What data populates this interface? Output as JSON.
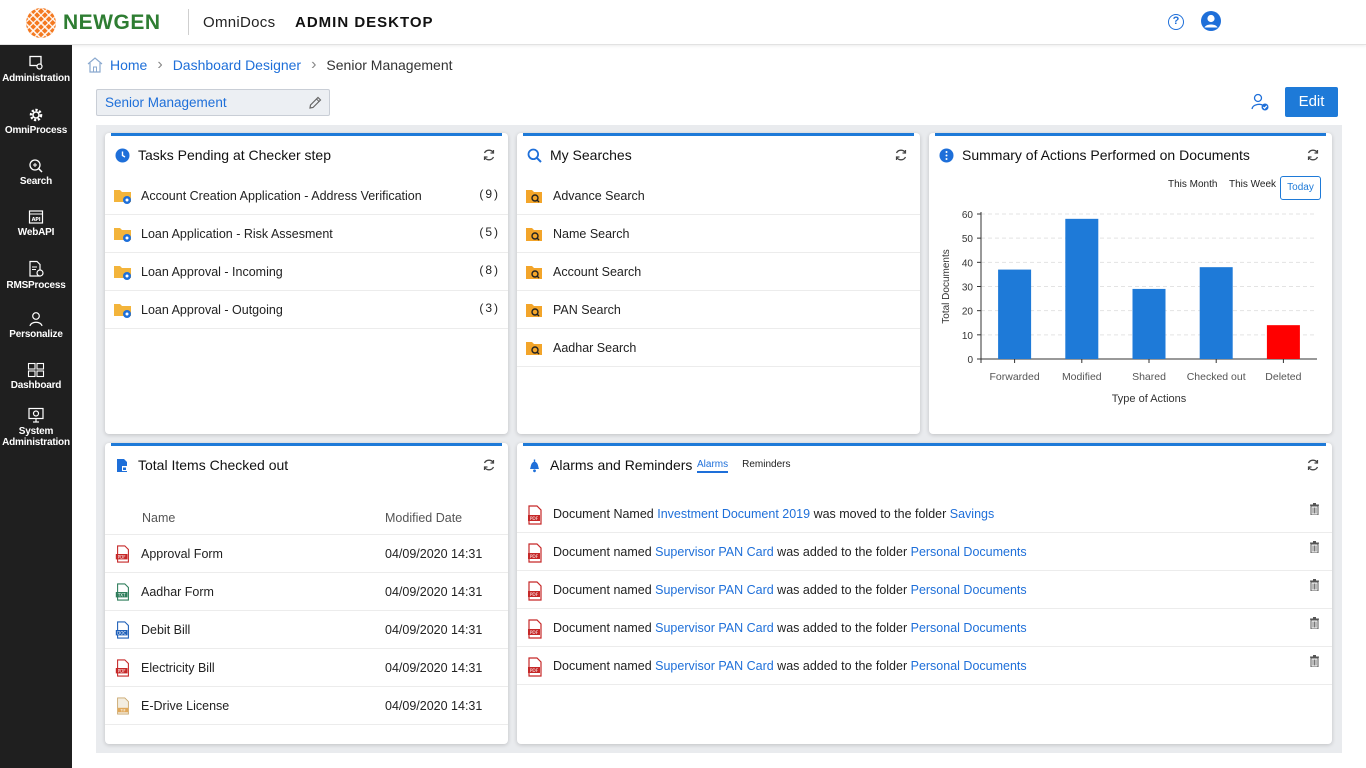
{
  "topbar": {
    "brand": "NEWGEN",
    "product": "OmniDocs",
    "app_title": "ADMIN DESKTOP"
  },
  "rail": [
    {
      "label": "Administration",
      "icon": "administration-icon"
    },
    {
      "label": "OmniProcess",
      "icon": "gear-icon"
    },
    {
      "label": "Search",
      "icon": "search-icon"
    },
    {
      "label": "WebAPI",
      "icon": "api-icon"
    },
    {
      "label": "RMSProcess",
      "icon": "document-gear-icon"
    },
    {
      "label": "Personalize",
      "icon": "person-icon"
    },
    {
      "label": "Dashboard",
      "icon": "dashboard-icon"
    },
    {
      "label": "System",
      "label2": "Administration",
      "icon": "monitor-gear-icon"
    }
  ],
  "breadcrumb": {
    "home": "Home",
    "designer": "Dashboard Designer",
    "current": "Senior Management"
  },
  "title": {
    "dashboard_name": "Senior Management",
    "edit_label": "Edit"
  },
  "tasks": {
    "title": "Tasks Pending at Checker step",
    "items": [
      {
        "label": "Account Creation Application - Address Verification",
        "count": "(9)"
      },
      {
        "label": "Loan Application - Risk Assesment",
        "count": "(5)"
      },
      {
        "label": "Loan Approval - Incoming",
        "count": "(8)"
      },
      {
        "label": "Loan Approval - Outgoing",
        "count": "(3)"
      }
    ]
  },
  "searches": {
    "title": "My Searches",
    "items": [
      "Advance Search",
      "Name Search",
      "Account Search",
      "PAN Search",
      "Aadhar Search"
    ]
  },
  "summary": {
    "title": "Summary of Actions Performed on Documents",
    "periods": [
      "This Month",
      "This Week",
      "Today"
    ],
    "selected_period": "Today"
  },
  "chart_data": {
    "type": "bar",
    "categories": [
      "Forwarded",
      "Modified",
      "Shared",
      "Checked out",
      "Deleted"
    ],
    "values": [
      37,
      58,
      29,
      38,
      14
    ],
    "colors": [
      "#1e7ad8",
      "#1e7ad8",
      "#1e7ad8",
      "#1e7ad8",
      "#ff0000"
    ],
    "xlabel": "Type of Actions",
    "ylabel": "Total Documents",
    "ylim": [
      0,
      60
    ],
    "yticks": [
      0,
      10,
      20,
      30,
      40,
      50,
      60
    ],
    "grid": true
  },
  "checked_out": {
    "title": "Total Items Checked out",
    "col_name": "Name",
    "col_date": "Modified Date",
    "rows": [
      {
        "name": "Approval Form",
        "date": "04/09/2020 14:31",
        "type": "pdf"
      },
      {
        "name": "Aadhar Form",
        "date": "04/09/2020 14:31",
        "type": "txt"
      },
      {
        "name": "Debit Bill",
        "date": "04/09/2020 14:31",
        "type": "doc"
      },
      {
        "name": "Electricity Bill",
        "date": "04/09/2020 14:31",
        "type": "pdf"
      },
      {
        "name": "E-Drive License",
        "date": "04/09/2020 14:31",
        "type": "tif"
      }
    ]
  },
  "alarms": {
    "title": "Alarms and Reminders",
    "tab_alarms": "Alarms",
    "tab_reminders": "Reminders",
    "rows": [
      {
        "pre": "Document Named ",
        "doc": "Investment Document 2019",
        "mid": " was moved to the folder ",
        "folder": "Savings"
      },
      {
        "pre": "Document named ",
        "doc": "Supervisor PAN Card",
        "mid": " was added to the folder ",
        "folder": "Personal Documents"
      },
      {
        "pre": "Document named ",
        "doc": "Supervisor PAN Card",
        "mid": " was added to the folder ",
        "folder": "Personal Documents"
      },
      {
        "pre": "Document named ",
        "doc": "Supervisor PAN Card",
        "mid": " was added to the folder ",
        "folder": "Personal Documents"
      },
      {
        "pre": "Document named ",
        "doc": "Supervisor PAN Card",
        "mid": " was added to the folder ",
        "folder": "Personal Documents"
      }
    ]
  }
}
